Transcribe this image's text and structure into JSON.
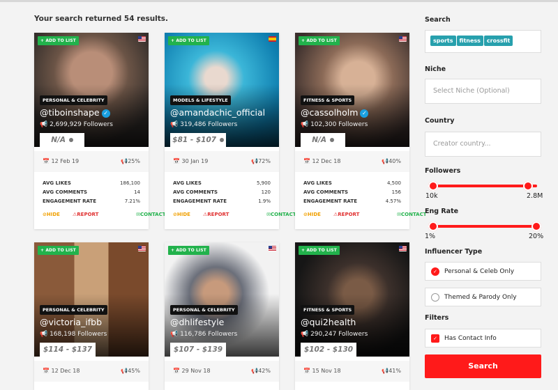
{
  "results_text": "Your search returned 54 results.",
  "cards": [
    {
      "add_label": "+ ADD TO LIST",
      "category": "PERSONAL & CELEBRITY",
      "handle": "@tiboinshape",
      "followers": "2,699,929 Followers",
      "price": "N/A",
      "date": "12 Feb 19",
      "engagement": "25%",
      "avg_likes": "186,100",
      "avg_comments": "14",
      "engagement_rate": "7.21%"
    },
    {
      "add_label": "+ ADD TO LIST",
      "category": "MODELS & LIFESTYLE",
      "handle": "@amandachic_official",
      "followers": "319,486 Followers",
      "price": "$81 - $107",
      "date": "30 Jan 19",
      "engagement": "72%",
      "avg_likes": "5,900",
      "avg_comments": "120",
      "engagement_rate": "1.9%"
    },
    {
      "add_label": "+ ADD TO LIST",
      "category": "FITNESS & SPORTS",
      "handle": "@cassolholm",
      "followers": "102,300 Followers",
      "price": "N/A",
      "date": "12 Dec 18",
      "engagement": "40%",
      "avg_likes": "4,500",
      "avg_comments": "156",
      "engagement_rate": "4.57%"
    },
    {
      "add_label": "+ ADD TO LIST",
      "category": "PERSONAL & CELEBRITY",
      "handle": "@victoria_ifbb",
      "followers": "168,198 Followers",
      "price": "$114 - $137",
      "date": "12 Dec 18",
      "engagement": "45%"
    },
    {
      "add_label": "+ ADD TO LIST",
      "category": "PERSONAL & CELEBRITY",
      "handle": "@dhlifestyle",
      "followers": "116,786 Followers",
      "price": "$107 - $139",
      "date": "29 Nov 18",
      "engagement": "42%"
    },
    {
      "add_label": "+ ADD TO LIST",
      "category": "FITNESS & SPORTS",
      "handle": "@qui2health",
      "followers": "290,247 Followers",
      "price": "$102 - $130",
      "date": "15 Nov 18",
      "engagement": "41%"
    }
  ],
  "stat_labels": {
    "avg_likes": "AVG LIKES",
    "avg_comments": "AVG COMMENTS",
    "engagement_rate": "ENGAGEMENT RATE"
  },
  "action_labels": {
    "hide": "HIDE",
    "report": "REPORT",
    "contact": "CONTACT"
  },
  "panel": {
    "search_label": "Search",
    "tags": [
      "sports",
      "fitness",
      "crossfit"
    ],
    "niche_label": "Niche",
    "niche_placeholder": "Select Niche (Optional)",
    "country_label": "Country",
    "country_placeholder": "Creator country...",
    "followers_label": "Followers",
    "followers_min": "10k",
    "followers_max": "2.8M",
    "eng_label": "Eng Rate",
    "eng_min": "1%",
    "eng_max": "20%",
    "type_label": "Influencer Type",
    "type_options": [
      "Personal & Celeb Only",
      "Themed & Parody Only"
    ],
    "filters_label": "Filters",
    "filter_option": "Has Contact Info",
    "search_button": "Search"
  },
  "colors": {
    "accent": "#ff1a1a",
    "add": "#22b24c",
    "tag": "#27a0ad",
    "verified": "#1aa0e0"
  }
}
